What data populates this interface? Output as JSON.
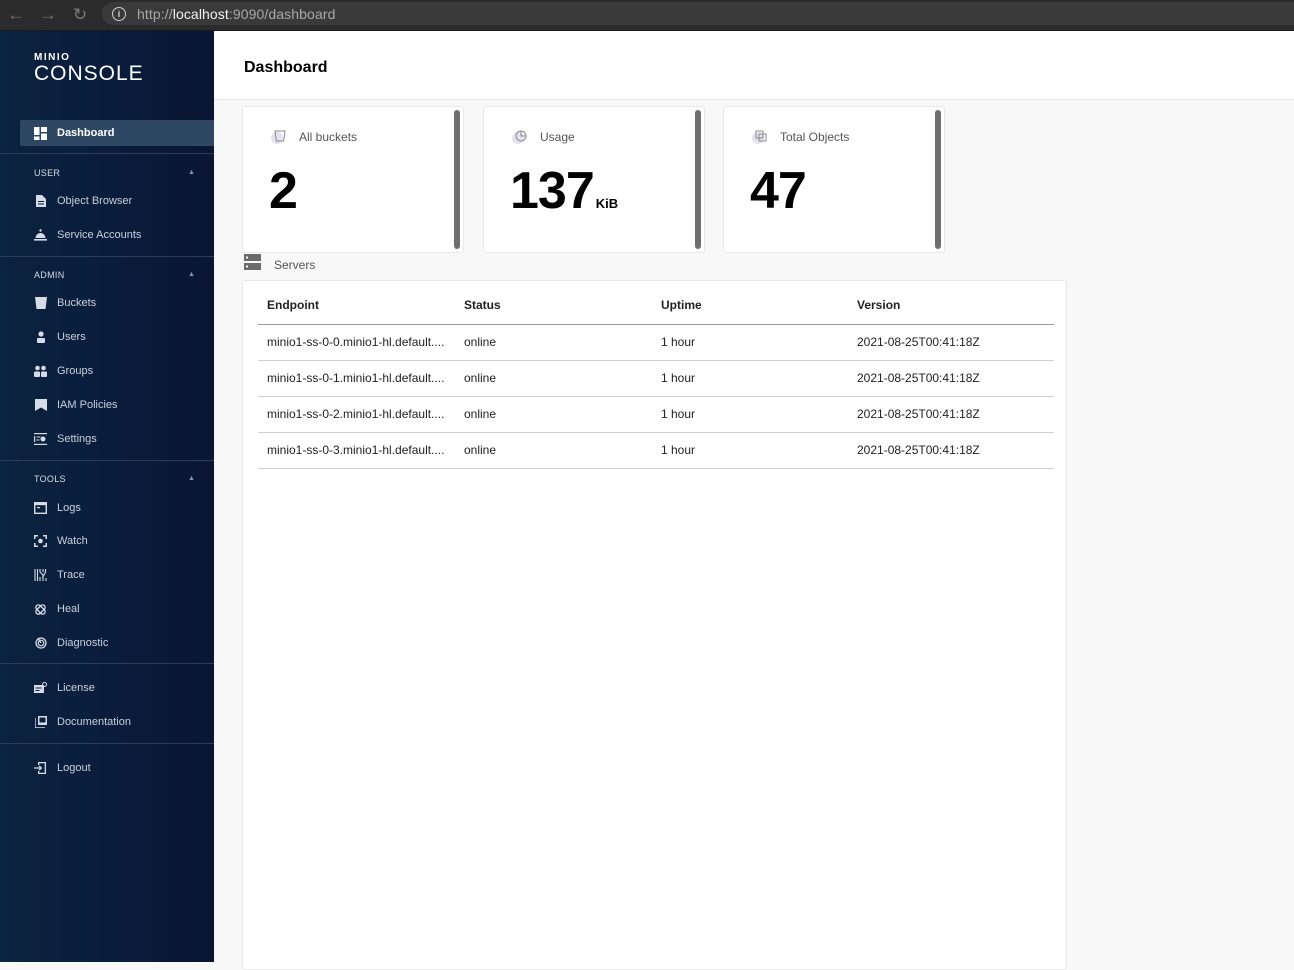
{
  "browser": {
    "url_prefix": "http://",
    "url_host": "localhost",
    "url_rest": ":9090/dashboard",
    "back_icon": "←",
    "forward_icon": "→",
    "reload_icon": "↻",
    "info_icon": "i"
  },
  "sidebar": {
    "logo_mini": "MINIO",
    "logo_main": "CONSOLE",
    "dashboard": {
      "label": "Dashboard",
      "icon": "dashboard-icon"
    },
    "sections": [
      {
        "label": "USER",
        "items": [
          {
            "label": "Object Browser",
            "icon": "document-icon"
          },
          {
            "label": "Service Accounts",
            "icon": "service-bell-icon"
          }
        ]
      },
      {
        "label": "ADMIN",
        "items": [
          {
            "label": "Buckets",
            "icon": "bucket-icon"
          },
          {
            "label": "Users",
            "icon": "user-icon"
          },
          {
            "label": "Groups",
            "icon": "group-icon"
          },
          {
            "label": "IAM Policies",
            "icon": "bookmark-icon"
          },
          {
            "label": "Settings",
            "icon": "settings-icon"
          }
        ]
      },
      {
        "label": "TOOLS",
        "items": [
          {
            "label": "Logs",
            "icon": "logs-icon"
          },
          {
            "label": "Watch",
            "icon": "watch-icon"
          },
          {
            "label": "Trace",
            "icon": "trace-icon"
          },
          {
            "label": "Heal",
            "icon": "heal-icon"
          },
          {
            "label": "Diagnostic",
            "icon": "diagnostic-icon"
          }
        ]
      }
    ],
    "extra": [
      {
        "label": "License",
        "icon": "license-icon"
      },
      {
        "label": "Documentation",
        "icon": "documentation-icon"
      }
    ],
    "logout": {
      "label": "Logout",
      "icon": "logout-icon"
    }
  },
  "header": {
    "title": "Dashboard"
  },
  "cards": [
    {
      "label": "All buckets",
      "value": "2",
      "unit": "",
      "icon": "bucket-icon"
    },
    {
      "label": "Usage",
      "value": "137",
      "unit": "KiB",
      "icon": "pie-chart-icon"
    },
    {
      "label": "Total Objects",
      "value": "47",
      "unit": "",
      "icon": "objects-icon"
    }
  ],
  "servers": {
    "title": "Servers",
    "columns": [
      "Endpoint",
      "Status",
      "Uptime",
      "Version"
    ],
    "rows": [
      {
        "endpoint": "minio1-ss-0-0.minio1-hl.default....",
        "status": "online",
        "uptime": "1 hour",
        "version": "2021-08-25T00:41:18Z"
      },
      {
        "endpoint": "minio1-ss-0-1.minio1-hl.default....",
        "status": "online",
        "uptime": "1 hour",
        "version": "2021-08-25T00:41:18Z"
      },
      {
        "endpoint": "minio1-ss-0-2.minio1-hl.default....",
        "status": "online",
        "uptime": "1 hour",
        "version": "2021-08-25T00:41:18Z"
      },
      {
        "endpoint": "minio1-ss-0-3.minio1-hl.default....",
        "status": "online",
        "uptime": "1 hour",
        "version": "2021-08-25T00:41:18Z"
      }
    ]
  }
}
